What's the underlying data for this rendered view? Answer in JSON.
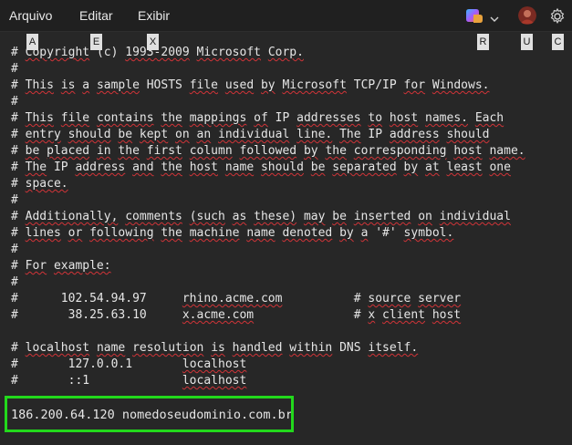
{
  "menu": {
    "items": [
      {
        "label": "Arquivo",
        "key": "A"
      },
      {
        "label": "Editar",
        "key": "E"
      },
      {
        "label": "Exibir",
        "key": "X"
      }
    ],
    "right_keys": [
      "R",
      "U",
      "C"
    ]
  },
  "editor": {
    "lines": [
      "# Copyright (c) 1993-2009 Microsoft Corp.",
      "#",
      "# This is a sample HOSTS file used by Microsoft TCP/IP for Windows.",
      "#",
      "# This file contains the mappings of IP addresses to host names. Each",
      "# entry should be kept on an individual line. The IP address should",
      "# be placed in the first column followed by the corresponding host name.",
      "# The IP address and the host name should be separated by at least one",
      "# space.",
      "#",
      "# Additionally, comments (such as these) may be inserted on individual",
      "# lines or following the machine name denoted by a '#' symbol.",
      "#",
      "# For example:",
      "#",
      "#      102.54.94.97     rhino.acme.com          # source server",
      "#       38.25.63.10     x.acme.com              # x client host",
      "",
      "# localhost name resolution is handled within DNS itself.",
      "#       127.0.0.1       localhost",
      "#       ::1             localhost"
    ],
    "highlighted_entry": "186.200.64.120 nomedoseudominio.com.br"
  },
  "colors": {
    "background": "#272727",
    "menubar": "#202020",
    "text": "#e6e6e6",
    "highlight_border": "#22d91c",
    "spellcheck": "#d13438"
  }
}
